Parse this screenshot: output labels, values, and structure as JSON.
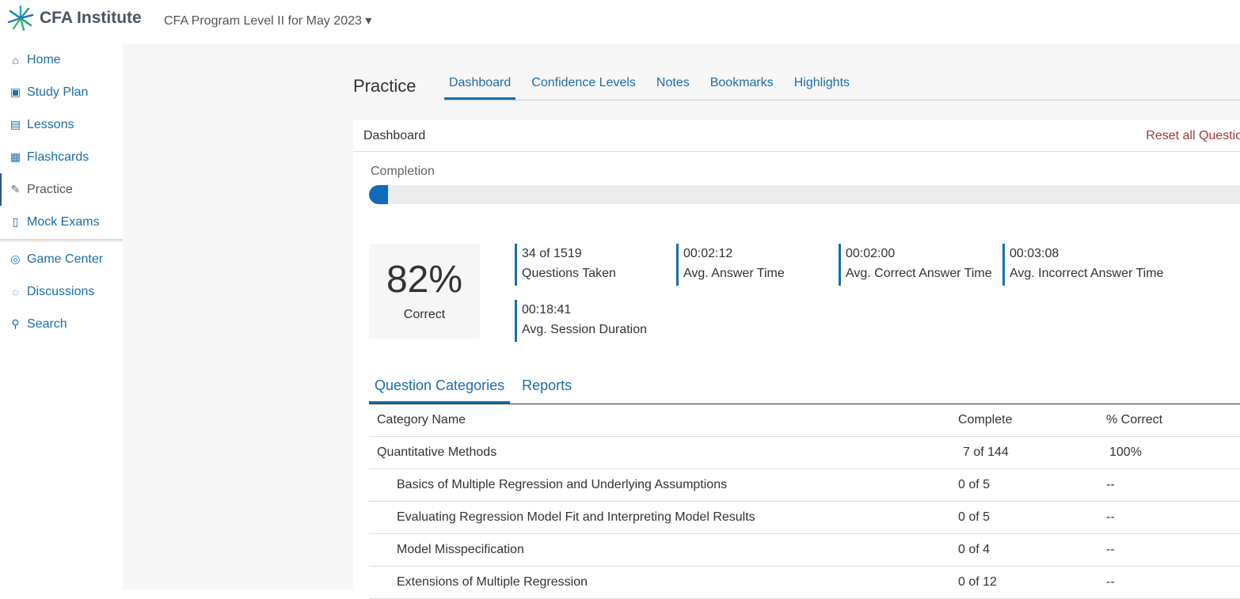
{
  "header": {
    "brand": "CFA Institute",
    "program": "CFA Program Level II for May 2023"
  },
  "sidebar": {
    "items": [
      {
        "label": "Home",
        "icon": "home-icon"
      },
      {
        "label": "Study Plan",
        "icon": "calendar-icon"
      },
      {
        "label": "Lessons",
        "icon": "book-icon"
      },
      {
        "label": "Flashcards",
        "icon": "flashcards-icon"
      },
      {
        "label": "Practice",
        "icon": "practice-icon",
        "active": true
      },
      {
        "label": "Mock Exams",
        "icon": "exam-icon"
      },
      {
        "label": "Game Center",
        "icon": "gamepad-icon"
      },
      {
        "label": "Discussions",
        "icon": "chat-icon"
      },
      {
        "label": "Search",
        "icon": "search-icon"
      }
    ]
  },
  "page": {
    "title": "Practice",
    "tabs": [
      "Dashboard",
      "Confidence Levels",
      "Notes",
      "Bookmarks",
      "Highlights"
    ],
    "active_tab": "Dashboard"
  },
  "dashboard": {
    "title": "Dashboard",
    "reset": "Reset all Questions",
    "completion_label": "Completion",
    "completion_percent": 2.2,
    "score": "82%",
    "score_label": "Correct",
    "stats": [
      {
        "value": "34 of 1519",
        "label": "Questions Taken"
      },
      {
        "value": "00:02:12",
        "label": "Avg. Answer Time"
      },
      {
        "value": "00:02:00",
        "label": "Avg. Correct Answer Time"
      },
      {
        "value": "00:03:08",
        "label": "Avg. Incorrect Answer Time"
      },
      {
        "value": "00:18:41",
        "label": "Avg. Session Duration"
      }
    ]
  },
  "subtabs": [
    "Question Categories",
    "Reports"
  ],
  "table": {
    "headers": [
      "Category Name",
      "Complete",
      "% Correct"
    ],
    "rows": [
      [
        "Quantitative Methods",
        "7 of 144",
        "100%"
      ],
      [
        "Basics of Multiple Regression and Underlying Assumptions",
        "0 of 5",
        "--"
      ],
      [
        "Evaluating Regression Model Fit and Interpreting Model Results",
        "0 of 5",
        "--"
      ],
      [
        "Model Misspecification",
        "0 of 4",
        "--"
      ],
      [
        "Extensions of Multiple Regression",
        "0 of 12",
        "--"
      ]
    ]
  },
  "colors": {
    "accent": "#1a6ea8",
    "progress": "#0f6cbd",
    "reset": "#a33a3a"
  }
}
